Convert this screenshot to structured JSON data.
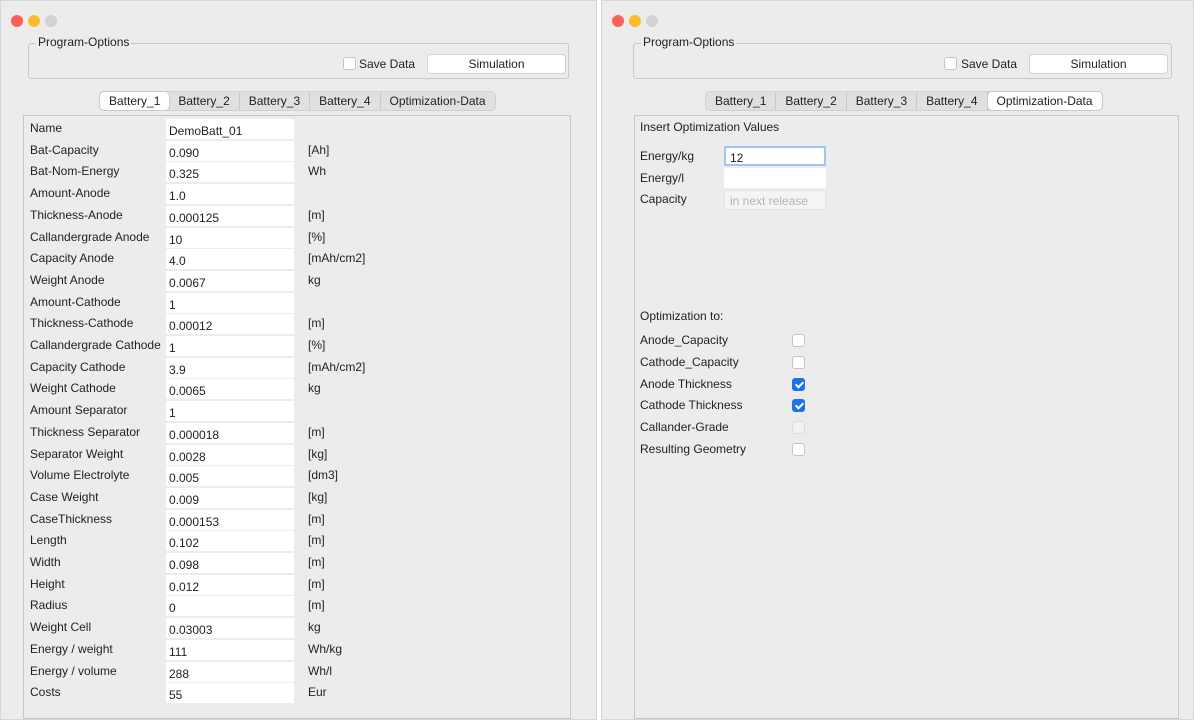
{
  "program_options": {
    "title": "Program-Options",
    "save_label": "Save Data",
    "save_checked": false,
    "simulation_label": "Simulation"
  },
  "tabs": [
    "Battery_1",
    "Battery_2",
    "Battery_3",
    "Battery_4",
    "Optimization-Data"
  ],
  "left_active_tab": "Battery_1",
  "right_active_tab": "Optimization-Data",
  "battery_rows": [
    {
      "label": "Name",
      "value": "DemoBatt_01",
      "unit": ""
    },
    {
      "label": "Bat-Capacity",
      "value": "0.090",
      "unit": "[Ah]"
    },
    {
      "label": "Bat-Nom-Energy",
      "value": "0.325",
      "unit": "Wh"
    },
    {
      "label": "Amount-Anode",
      "value": "1.0",
      "unit": ""
    },
    {
      "label": "Thickness-Anode",
      "value": "0.000125",
      "unit": "[m]"
    },
    {
      "label": "Callandergrade Anode",
      "value": "10",
      "unit": "[%]"
    },
    {
      "label": "Capacity Anode",
      "value": "4.0",
      "unit": "[mAh/cm2]"
    },
    {
      "label": "Weight Anode",
      "value": "0.0067",
      "unit": "kg"
    },
    {
      "label": "Amount-Cathode",
      "value": "1",
      "unit": ""
    },
    {
      "label": "Thickness-Cathode",
      "value": "0.00012",
      "unit": "[m]"
    },
    {
      "label": "Callandergrade Cathode",
      "value": "1",
      "unit": "[%]"
    },
    {
      "label": "Capacity Cathode",
      "value": "3.9",
      "unit": "[mAh/cm2]"
    },
    {
      "label": "Weight Cathode",
      "value": "0.0065",
      "unit": "kg"
    },
    {
      "label": "Amount Separator",
      "value": "1",
      "unit": ""
    },
    {
      "label": "Thickness Separator",
      "value": "0.000018",
      "unit": "[m]"
    },
    {
      "label": "Separator Weight",
      "value": "0.0028",
      "unit": "[kg]"
    },
    {
      "label": "Volume Electrolyte",
      "value": "0.005",
      "unit": "[dm3]"
    },
    {
      "label": "Case Weight",
      "value": "0.009",
      "unit": "[kg]"
    },
    {
      "label": "CaseThickness",
      "value": "0.000153",
      "unit": "[m]"
    },
    {
      "label": "Length",
      "value": "0.102",
      "unit": "[m]"
    },
    {
      "label": "Width",
      "value": "0.098",
      "unit": "[m]"
    },
    {
      "label": "Height",
      "value": "0.012",
      "unit": "[m]"
    },
    {
      "label": "Radius",
      "value": "0",
      "unit": "[m]"
    },
    {
      "label": "Weight Cell",
      "value": "0.03003",
      "unit": "kg"
    },
    {
      "label": "Energy / weight",
      "value": "111",
      "unit": "Wh/kg"
    },
    {
      "label": "Energy / volume",
      "value": "288",
      "unit": "Wh/l"
    },
    {
      "label": "Costs",
      "value": "55",
      "unit": "Eur"
    }
  ],
  "optimization": {
    "title": "Insert Optimization Values",
    "fields": [
      {
        "label": "Energy/kg",
        "value": "12",
        "placeholder": "",
        "focused": true
      },
      {
        "label": "Energy/l",
        "value": "",
        "placeholder": "",
        "focused": false
      },
      {
        "label": "Capacity",
        "value": "",
        "placeholder": "in next release",
        "focused": false
      }
    ],
    "targets_title": "Optimization to:",
    "targets": [
      {
        "label": "Anode_Capacity",
        "checked": false,
        "disabled": false
      },
      {
        "label": "Cathode_Capacity",
        "checked": false,
        "disabled": false
      },
      {
        "label": "Anode Thickness",
        "checked": true,
        "disabled": false
      },
      {
        "label": "Cathode Thickness",
        "checked": true,
        "disabled": false
      },
      {
        "label": "Callander-Grade",
        "checked": false,
        "disabled": true
      },
      {
        "label": "Resulting Geometry",
        "checked": false,
        "disabled": false
      }
    ]
  },
  "colors": {
    "accent": "#1a73e8",
    "window_bg": "#ececec",
    "close": "#fe5f57",
    "minimize": "#fdbc2e"
  }
}
